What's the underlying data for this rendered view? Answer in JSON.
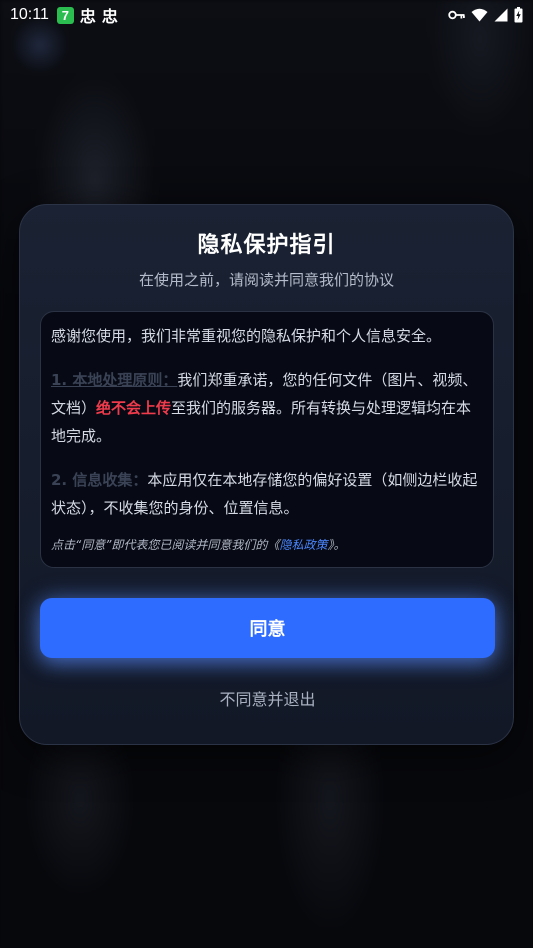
{
  "status_bar": {
    "time": "10:11",
    "app_badge": "7",
    "notification_1": "忠",
    "notification_2": "忠",
    "icons": [
      "key-icon",
      "wifi-icon",
      "signal-icon",
      "battery-charging-icon"
    ]
  },
  "dialog": {
    "title": "隐私保护指引",
    "subtitle": "在使用之前，请阅读并同意我们的协议",
    "intro": "感谢您使用，我们非常重视您的隐私保护和个人信息安全。",
    "point1": {
      "label": "1. 本地处理原则：",
      "text_before": "我们郑重承诺，您的任何文件（图片、视频、文档）",
      "highlight": "绝不会上传",
      "text_after": "至我们的服务器。所有转换与处理逻辑均在本地完成。"
    },
    "point2": {
      "label": "2. 信息收集：",
      "text": "本应用仅在本地存储您的偏好设置（如侧边栏收起状态），不收集您的身份、位置信息。"
    },
    "notice": {
      "before": "点击“同意”即代表您已阅读并同意我们的《",
      "link": "隐私政策",
      "after": "》。"
    },
    "agree_label": "同意",
    "disagree_label": "不同意并退出"
  },
  "colors": {
    "accent": "#2e6bff",
    "highlight_red": "#ef3b4c",
    "link": "#4a86ff",
    "background": "#07080c",
    "dialog_bg": "#161d2c"
  }
}
